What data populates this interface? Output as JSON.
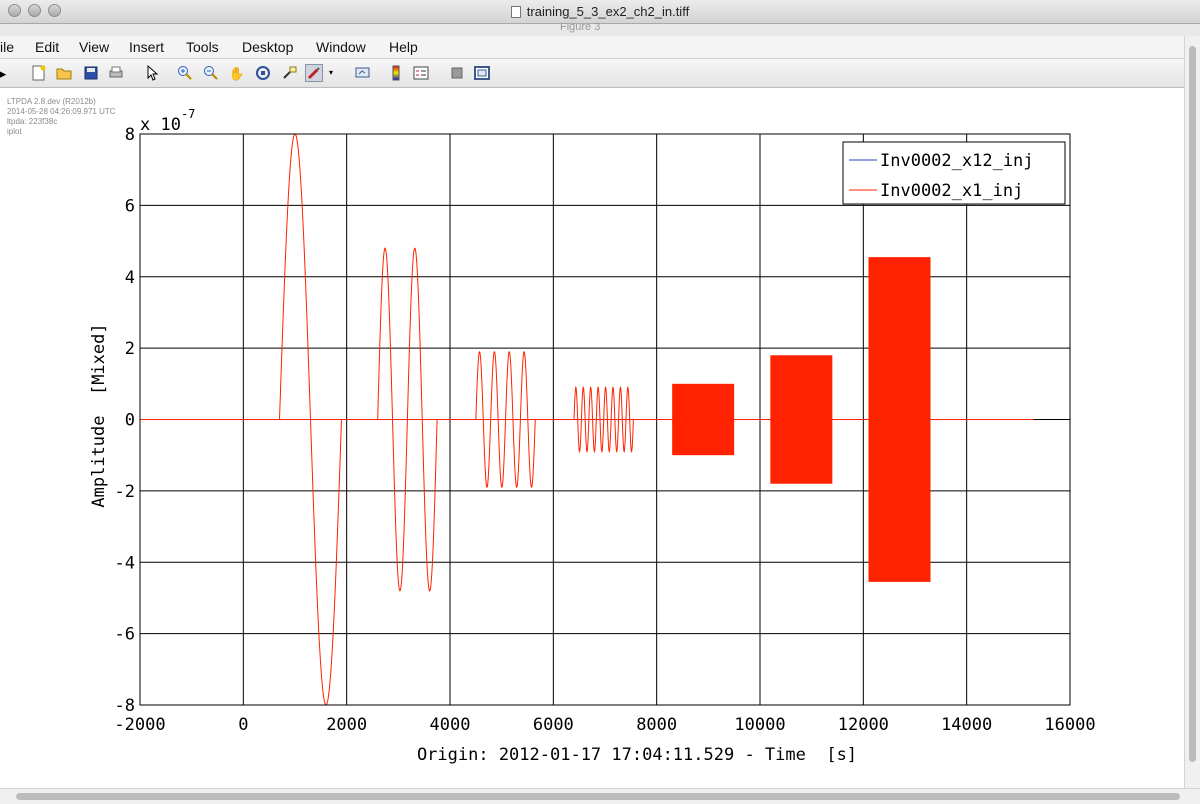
{
  "window": {
    "title": "training_5_3_ex2_ch2_in.tiff",
    "subtitle": "Figure 3"
  },
  "menu": [
    "ile",
    "Edit",
    "View",
    "Insert",
    "Tools",
    "Desktop",
    "Window",
    "Help"
  ],
  "toolbar": {
    "icons": [
      "arrow-icon",
      "new-figure-icon",
      "open-file-icon",
      "save-icon",
      "print-icon",
      "select-pointer-icon",
      "zoom-in-icon",
      "zoom-out-icon",
      "pan-icon",
      "rotate-3d-icon",
      "data-cursor-icon",
      "brush-icon",
      "brush-dropdown-icon",
      "link-plot-icon",
      "colorbar-icon",
      "legend-icon",
      "hide-plot-tools-icon",
      "show-plot-tools-icon"
    ]
  },
  "meta": {
    "line1": "LTPDA 2.8.dev (R2012b)",
    "line2": "2014-05-28 04:26:09.971 UTC",
    "line3": "ltpda: 223f38c",
    "line4": "iplot"
  },
  "colors": {
    "series1": "#2a3cb8",
    "series2": "#ff2200",
    "axes": "#000000",
    "grid": "#000000",
    "background": "#ffffff"
  },
  "chart_data": {
    "type": "line",
    "xlabel": "Origin: 2012-01-17 17:04:11.529 - Time  [s]",
    "ylabel": "Amplitude  [Mixed]",
    "y_exponent": "x 10",
    "y_exponent_power": "-7",
    "xlim": [
      -2000,
      16000
    ],
    "ylim": [
      -8,
      8
    ],
    "xticks": [
      -2000,
      0,
      2000,
      4000,
      6000,
      8000,
      10000,
      12000,
      14000,
      16000
    ],
    "yticks": [
      -8,
      -6,
      -4,
      -2,
      0,
      2,
      4,
      6,
      8
    ],
    "grid": true,
    "legend_position": "top-right",
    "series": [
      {
        "name": "Inv0002_x12_inj",
        "values": [
          [
            -2000,
            0
          ],
          [
            15300,
            0
          ]
        ]
      },
      {
        "name": "Inv0002_x1_inj",
        "values": [
          [
            -2000,
            0
          ],
          [
            15300,
            0
          ]
        ]
      }
    ],
    "x1_inj_bursts": [
      {
        "x_start": 700,
        "x_end": 1900,
        "amplitude": 8.0,
        "cycles": 1.0
      },
      {
        "x_start": 2600,
        "x_end": 3750,
        "amplitude": 4.8,
        "cycles": 2.0
      },
      {
        "x_start": 4500,
        "x_end": 5650,
        "amplitude": 1.9,
        "cycles": 4.0
      },
      {
        "x_start": 6400,
        "x_end": 7550,
        "amplitude": 0.9,
        "cycles": 8.0
      },
      {
        "x_start": 8300,
        "x_end": 9500,
        "amplitude": 1.0,
        "cycles": 16.0
      },
      {
        "x_start": 10200,
        "x_end": 11400,
        "amplitude": 1.8,
        "cycles": 32.0
      },
      {
        "x_start": 12100,
        "x_end": 13300,
        "amplitude": 4.55,
        "cycles": 200.0
      }
    ]
  }
}
